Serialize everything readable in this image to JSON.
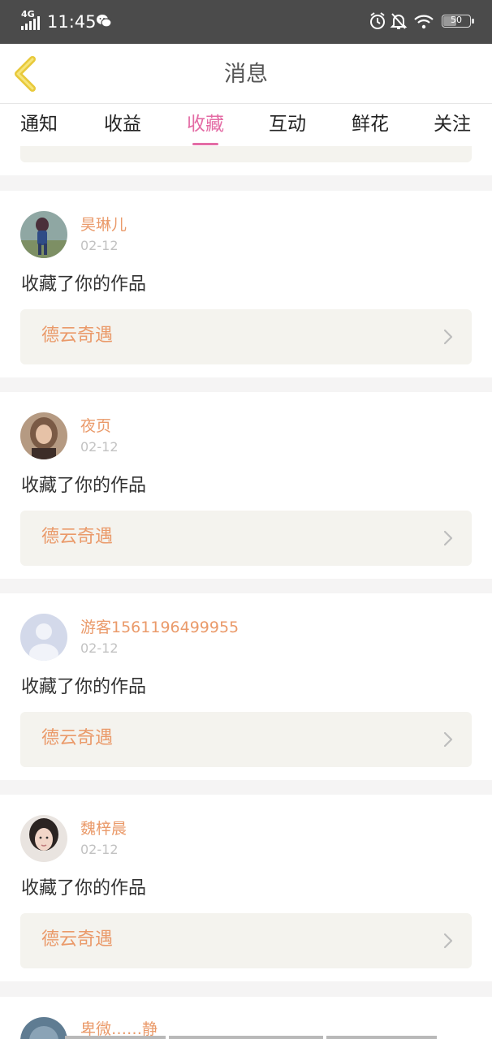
{
  "status_bar": {
    "network": "4G",
    "time": "11:45",
    "battery": "50",
    "icons": [
      "signal-icon",
      "wechat-icon",
      "alarm-icon",
      "notifications-off-icon",
      "wifi-icon",
      "battery-icon"
    ]
  },
  "header": {
    "title": "消息",
    "back_icon": "chevron-left-icon"
  },
  "tabs": [
    {
      "label": "通知",
      "active": false
    },
    {
      "label": "收益",
      "active": false
    },
    {
      "label": "收藏",
      "active": true
    },
    {
      "label": "互动",
      "active": false
    },
    {
      "label": "鲜花",
      "active": false
    },
    {
      "label": "关注",
      "active": false
    }
  ],
  "colors": {
    "accent": "#e46ca5",
    "name": "#ea9a6a",
    "card_bg": "#f4f3ee",
    "status_bar": "#4b4b4b"
  },
  "notifications": [
    {
      "username": "昊琳儿",
      "date": "02-12",
      "action": "收藏了你的作品",
      "work_title": "德云奇遇"
    },
    {
      "username": "夜页",
      "date": "02-12",
      "action": "收藏了你的作品",
      "work_title": "德云奇遇"
    },
    {
      "username": "游客1561196499955",
      "date": "02-12",
      "action": "收藏了你的作品",
      "work_title": "德云奇遇"
    },
    {
      "username": "魏梓晨",
      "date": "02-12",
      "action": "收藏了你的作品",
      "work_title": "德云奇遇"
    },
    {
      "username": "卑微……静",
      "date": "",
      "action": "",
      "work_title": ""
    }
  ]
}
